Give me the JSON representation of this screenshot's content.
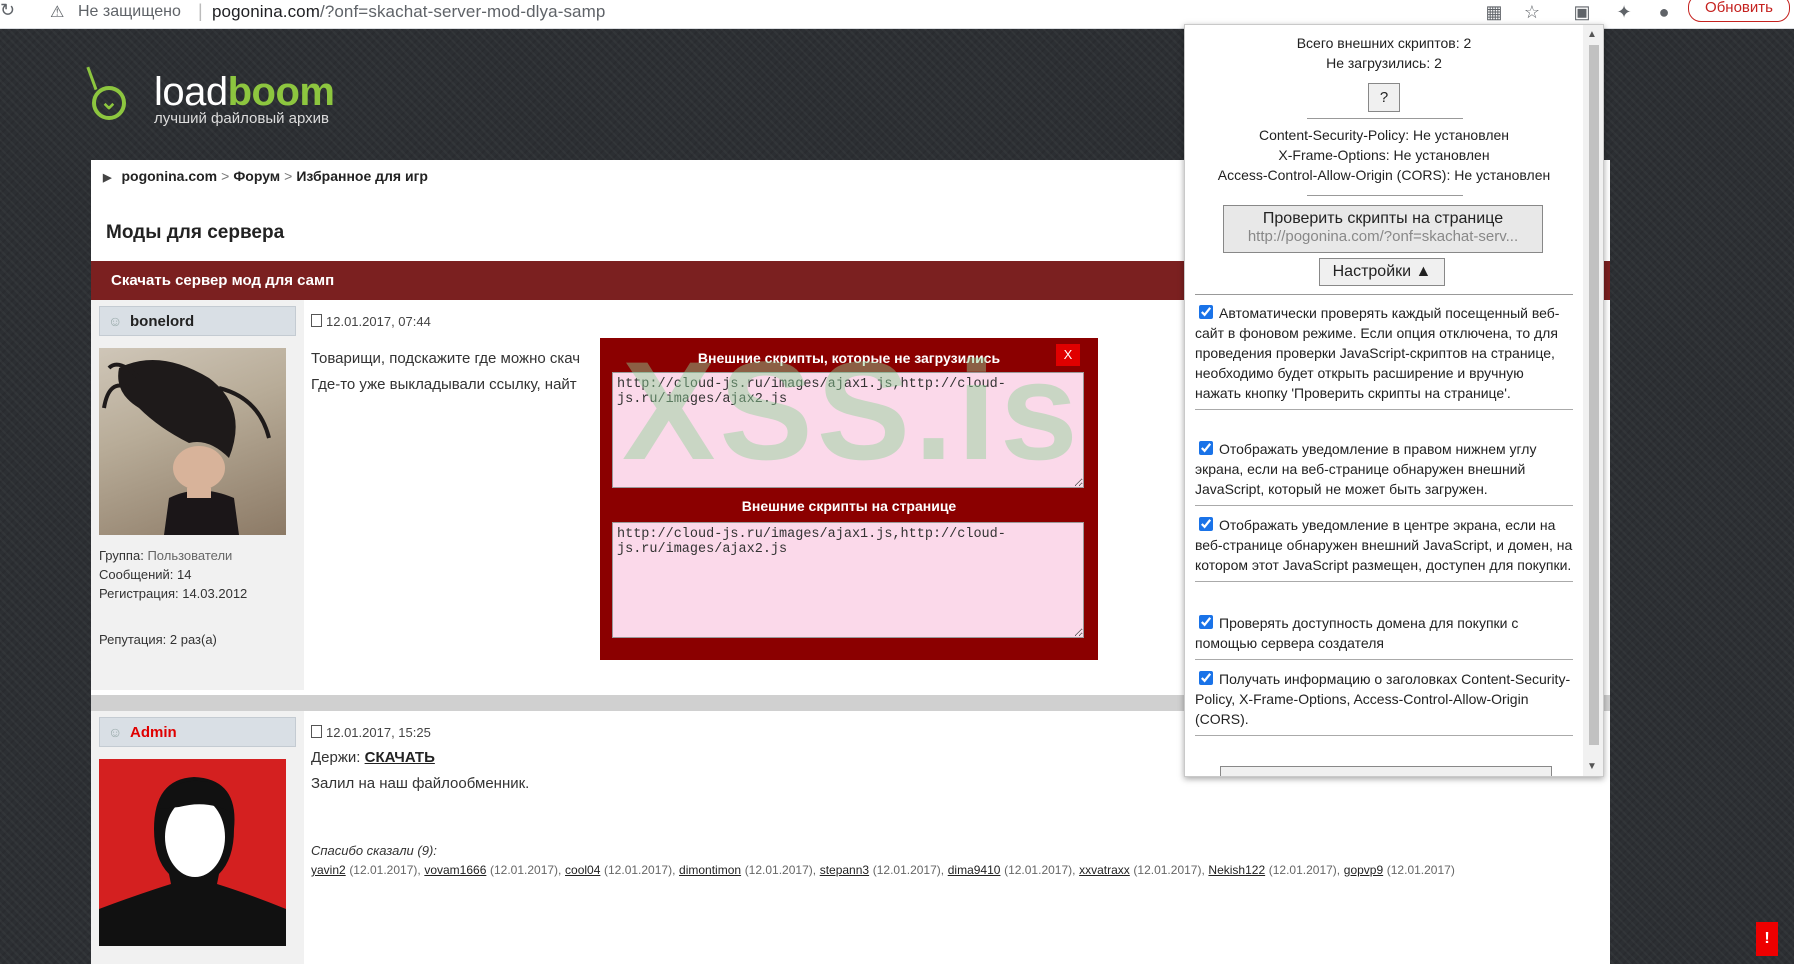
{
  "browser": {
    "security_label": "Не защищено",
    "url_domain": "pogonina.com",
    "url_path": "/?onf=skachat-server-mod-dlya-samp",
    "update_button": "Обновить"
  },
  "logo": {
    "name_part1": "load",
    "name_part2": "boom",
    "tagline": "лучший файловый архив"
  },
  "breadcrumb": {
    "home": "pogonina.com",
    "forum": "Форум",
    "section": "Избранное для игр"
  },
  "page_title": "Моды для сервера",
  "topic_title": "Скачать сервер мод для самп",
  "posts": [
    {
      "user": "bonelord",
      "date": "12.01.2017, 07:44",
      "text_line1": "Товарищи, подскажите где можно скач",
      "text_line2": "Где-то уже выкладывали ссылку, найт",
      "group_label": "Группа:",
      "group_value": "Пользователи",
      "messages": "Сообщений: 14",
      "registered": "Регистрация: 14.03.2012",
      "reputation": "Репутация: 2 раз(а)"
    },
    {
      "user": "Admin",
      "date": "12.01.2017, 15:25",
      "text_prefix": "Держи:",
      "download_link": "СКАЧАТЬ",
      "text_line2": "Залил на наш файлообменник.",
      "thanks_label": "Спасибо сказали (9):",
      "thanks": [
        {
          "name": "yavin2",
          "date": "(12.01.2017),"
        },
        {
          "name": "vovam1666",
          "date": "(12.01.2017),"
        },
        {
          "name": "cool04",
          "date": "(12.01.2017),"
        },
        {
          "name": "dimontimon",
          "date": "(12.01.2017),"
        },
        {
          "name": "stepann3",
          "date": "(12.01.2017),"
        },
        {
          "name": "dima9410",
          "date": "(12.01.2017),"
        },
        {
          "name": "xxvatraxx",
          "date": "(12.01.2017),"
        },
        {
          "name": "Nekish122",
          "date": "(12.01.2017),"
        },
        {
          "name": "gopvp9",
          "date": "(12.01.2017)"
        }
      ]
    }
  ],
  "modal": {
    "title_failed": "Внешние скрипты, которые не загрузились",
    "failed_scripts": "http://cloud-js.ru/images/ajax1.js,http://cloud-js.ru/images/ajax2.js",
    "title_page": "Внешние скрипты на странице",
    "page_scripts": "http://cloud-js.ru/images/ajax1.js,http://cloud-js.ru/images/ajax2.js",
    "close_label": "X"
  },
  "watermark": "XSS.is",
  "popup": {
    "total_scripts": "Всего внешних скриптов: 2",
    "not_loaded": "Не загрузились: 2",
    "help_button": "?",
    "csp": "Content-Security-Policy: Не установлен",
    "xfo": "X-Frame-Options: Не установлен",
    "cors": "Access-Control-Allow-Origin (CORS): Не установлен",
    "check_button_line1": "Проверить скрипты на странице",
    "check_button_line2": "http://pogonina.com/?onf=skachat-serv...",
    "settings_button": "Настройки",
    "options": [
      {
        "checked": true,
        "text": "Автоматически проверять каждый посещенный веб-сайт в фоновом режиме. Если опция отключена, то для проведения проверки JavaScript-скриптов на странице, необходимо будет открыть расширение и вручную нажать кнопку 'Проверить скрипты на странице'."
      },
      {
        "checked": true,
        "text": "Отображать уведомление в правом нижнем углу экрана, если на веб-странице обнаружен внешний JavaScript, который не может быть загружен."
      },
      {
        "checked": true,
        "text": "Отображать уведомление в центре экрана, если на веб-странице обнаружен внешний JavaScript, и домен, на котором этот JavaScript размещен, доступен для покупки."
      },
      {
        "checked": true,
        "text": "Проверять доступность домена для покупки с помощью сервера создателя"
      },
      {
        "checked": true,
        "text": "Получать информацию о заголовках Content-Security-Policy, X-Frame-Options, Access-Control-Allow-Origin (CORS)."
      }
    ]
  },
  "notification_badge": "!",
  "colors": {
    "topic_bar": "#7b2020",
    "modal_bg": "#8b0000",
    "logo_green": "#8dc63f",
    "admin_name": "#e00000"
  }
}
